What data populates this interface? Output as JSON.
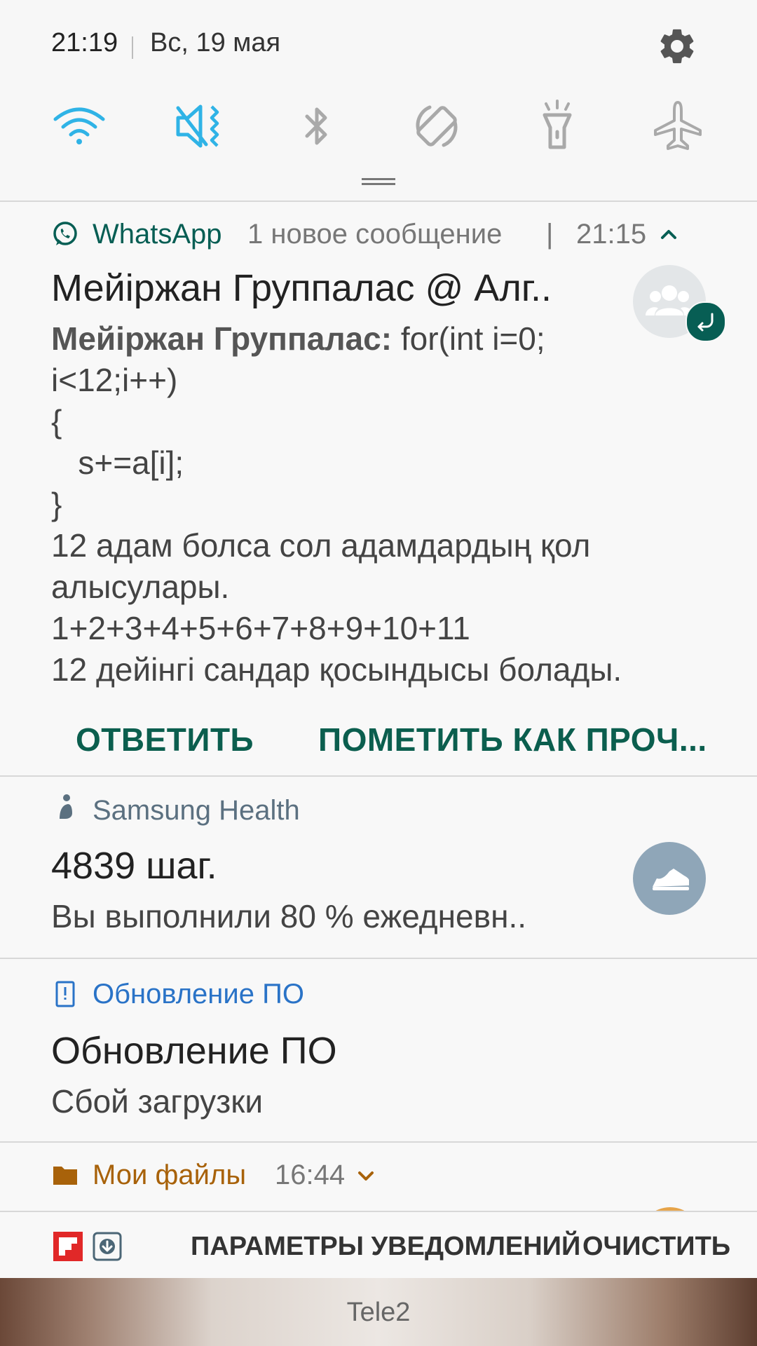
{
  "status": {
    "time": "21:19",
    "date": "Вс, 19 мая"
  },
  "quick_settings": [
    {
      "icon": "wifi-icon",
      "active": true
    },
    {
      "icon": "mute-vibrate-icon",
      "active": true
    },
    {
      "icon": "bluetooth-icon",
      "active": false
    },
    {
      "icon": "auto-rotate-icon",
      "active": false
    },
    {
      "icon": "flashlight-icon",
      "active": false
    },
    {
      "icon": "airplane-icon",
      "active": false
    }
  ],
  "colors": {
    "accent_active": "#2fb3e6",
    "inactive_icon": "#a9a9a9",
    "whatsapp": "#075e54",
    "health": "#5b7080",
    "update": "#2a73c7",
    "files": "#a8620a"
  },
  "whatsapp": {
    "app_name": "WhatsApp",
    "summary": "1 новое сообщение",
    "separator": "|",
    "time": "21:15",
    "title": "Мейіржан Группалас @ Алг..",
    "sender": "Мейіржан Группалас:",
    "first_line": " for(int i=0;",
    "body_lines": [
      "i<12;i++)",
      "{",
      "   s+=a[i];",
      "}",
      "12 адам болса сол адамдардың қол",
      "алысулары.",
      "1+2+3+4+5+6+7+8+9+10+11",
      "12 дейінгі сандар қосындысы болады."
    ],
    "reply_label": "ОТВЕТИТЬ",
    "mark_read_label": "ПОМЕТИТЬ КАК ПРОЧ..."
  },
  "health": {
    "app_name": "Samsung Health",
    "title": "4839 шаг.",
    "text": "Вы выполнили 80 % ежедневн.."
  },
  "update": {
    "app_name": "Обновление ПО",
    "title": "Обновление ПО",
    "text": "Сбой загрузки"
  },
  "files": {
    "app_name": "Мои файлы",
    "time": "16:44"
  },
  "bottom_bar": {
    "settings_label": "ПАРАМЕТРЫ УВЕДОМЛЕНИЙ",
    "clear_label": "ОЧИСТИТЬ"
  },
  "carrier": "Tele2"
}
